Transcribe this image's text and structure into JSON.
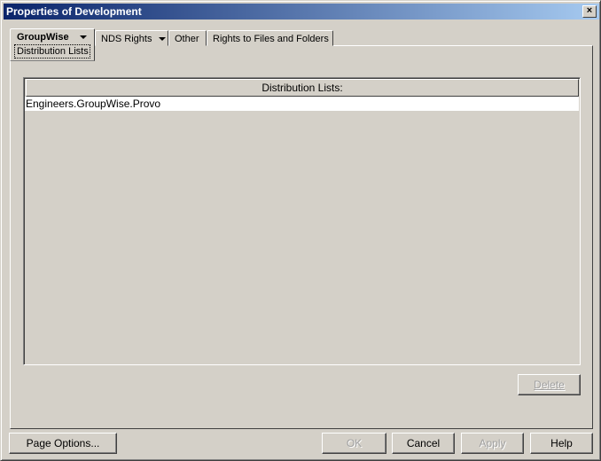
{
  "window": {
    "title": "Properties of Development",
    "close_label": "×"
  },
  "tabs": [
    {
      "label": "GroupWise",
      "sub_label": "Distribution Lists",
      "selected": true,
      "has_dropdown": true
    },
    {
      "label": "NDS Rights",
      "has_dropdown": true
    },
    {
      "label": "Other"
    },
    {
      "label": "Rights to Files and Folders"
    }
  ],
  "list": {
    "header": "Distribution Lists:",
    "items": [
      "Engineers.GroupWise.Provo"
    ]
  },
  "buttons": {
    "delete": "Delete",
    "page_options": "Page Options...",
    "ok": "OK",
    "cancel": "Cancel",
    "apply": "Apply",
    "help": "Help"
  }
}
